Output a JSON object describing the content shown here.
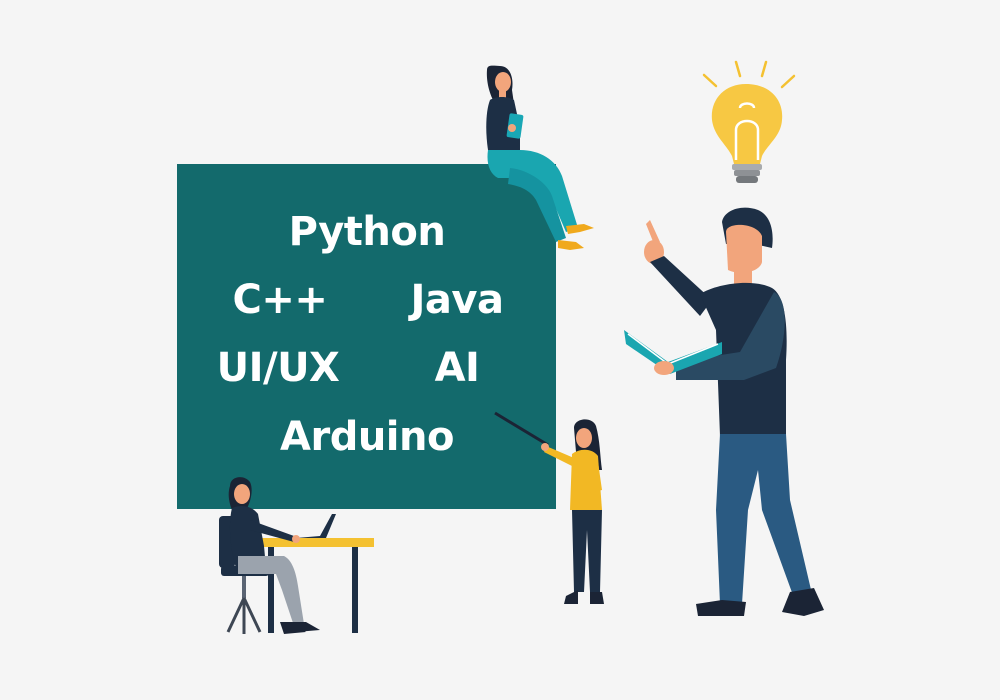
{
  "board": {
    "words": [
      "Python",
      "C++",
      "Java",
      "UI/UX",
      "AI",
      "Arduino"
    ]
  },
  "colors": {
    "background": "#f5f5f5",
    "board": "#136a6c",
    "text": "#ffffff",
    "bulb": "#f7c843",
    "desk": "#f4c131",
    "navy": "#1d2f45",
    "teal_pants": "#1aa6b0",
    "yellow_shirt": "#f2b824"
  },
  "icons": [
    "lightbulb-icon",
    "laptop-icon",
    "tablet-icon",
    "book-icon",
    "pointer-stick-icon"
  ]
}
